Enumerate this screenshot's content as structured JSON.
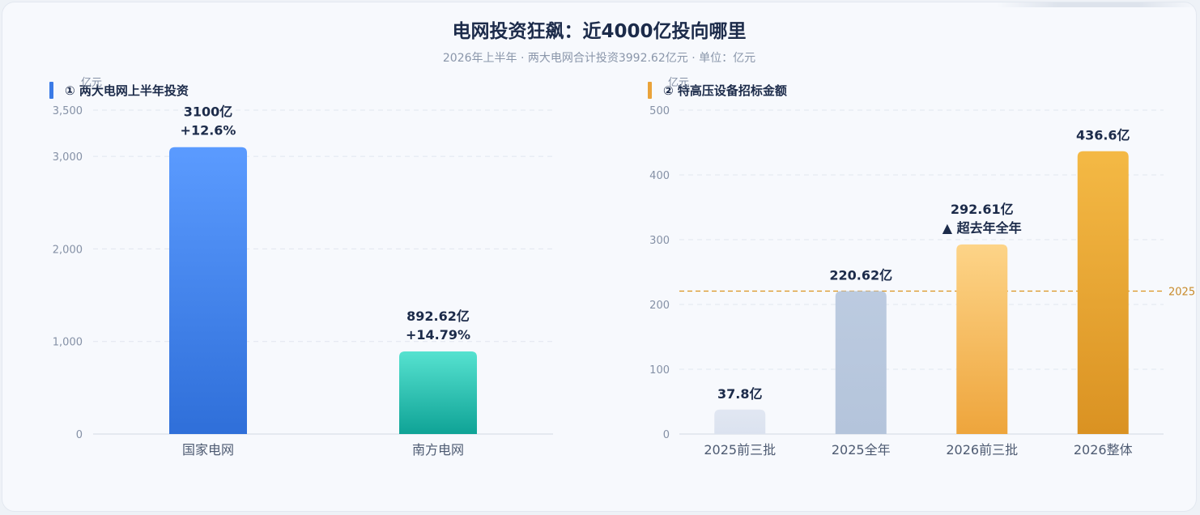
{
  "title": "电网投资狂飙：近4000亿投向哪里",
  "subtitle": "2026年上半年 · 两大电网合计投资3992.62亿元 · 单位：亿元",
  "colors": {
    "accent_blue": "#3b7be6",
    "accent_orange": "#eaa33a",
    "refline": "#d9951f"
  },
  "chart_data": [
    {
      "type": "bar",
      "title": "① 两大电网上半年投资",
      "ylabel": "亿元",
      "ylim": [
        0,
        3500
      ],
      "yticks": [
        0,
        1000,
        2000,
        3000,
        3500
      ],
      "ytick_labels": [
        "0",
        "1,000",
        "2,000",
        "3,000",
        "3,500"
      ],
      "grid": true,
      "categories": [
        "国家电网",
        "南方电网"
      ],
      "values": [
        3100,
        892.62
      ],
      "labels": [
        "3100亿",
        "892.62亿"
      ],
      "sublabels": [
        "+12.6%",
        "+14.79%"
      ],
      "colors": [
        [
          "#5b9bff",
          "#2f6fd9"
        ],
        [
          "#56e2d0",
          "#0fa396"
        ]
      ]
    },
    {
      "type": "bar",
      "title": "② 特高压设备招标金额",
      "ylabel": "亿元",
      "ylim": [
        0,
        500
      ],
      "yticks": [
        0,
        100,
        200,
        300,
        400,
        500
      ],
      "ytick_labels": [
        "0",
        "100",
        "200",
        "300",
        "400",
        "500"
      ],
      "grid": true,
      "categories": [
        "2025前三批",
        "2025全年",
        "2026前三批",
        "2026整体"
      ],
      "values": [
        37.8,
        220.62,
        292.61,
        436.6
      ],
      "labels": [
        "37.8亿",
        "220.62亿",
        "292.61亿",
        "436.6亿"
      ],
      "sublabels": [
        "",
        "",
        "▲ 超去年全年",
        ""
      ],
      "colors": [
        [
          "#e1e7f2",
          "#dbe2ef"
        ],
        [
          "#bccbe0",
          "#b4c4db"
        ],
        [
          "#fdd488",
          "#eea53c"
        ],
        [
          "#f4b945",
          "#da9222"
        ]
      ],
      "reference_line": {
        "value": 220.62,
        "label": "2025"
      }
    }
  ]
}
